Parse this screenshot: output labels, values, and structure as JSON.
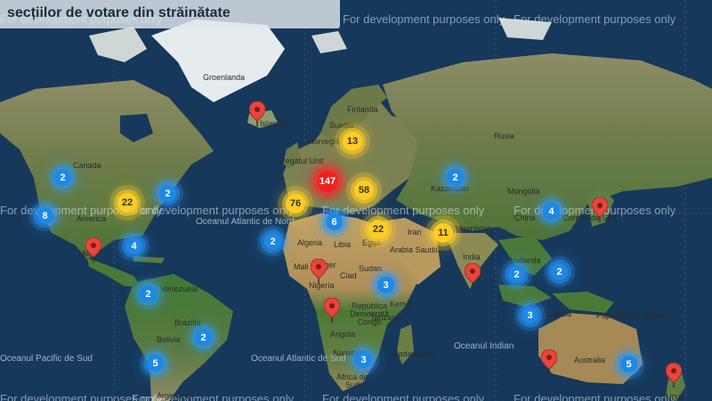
{
  "title": "secțiilor de votare din străinătate",
  "watermark": "For development purposes only",
  "colors": {
    "ocean": "#16385a",
    "land_north": "#8a8a63",
    "land_tropic": "#4d7a3a",
    "desert": "#b89a60",
    "ice": "#e8ecef",
    "cluster_small": "#1e88e5",
    "cluster_medium": "#ffcc22",
    "cluster_large": "#ee2222",
    "pin": "#e8453c"
  },
  "map_labels": {
    "greenland": "Groenlanda",
    "iceland": "Islanda",
    "finland": "Finlanda",
    "sweden": "Suedia",
    "norway": "Norvegia",
    "russia": "Rusia",
    "uk": "Regatul Unit",
    "kazakhstan": "Kazahstan",
    "mongolia": "Mongolia",
    "china": "China",
    "korea": "Coreea de Sud",
    "canada": "Canada",
    "usa": "America",
    "mexico": "Mexic",
    "atlantic_north": "Oceanul Atlantic de Nord",
    "atlantic_south": "Oceanul Atlantic de Sud",
    "pacific": "Oceanul Pacific de Sud",
    "indian": "Oceanul Indian",
    "algeria": "Algeria",
    "libya": "Libia",
    "egypt": "Egipt",
    "mali": "Mali",
    "niger": "Niger",
    "chad": "Ciad",
    "sudan": "Sudan",
    "nigeria": "Nigeria",
    "saudi": "Arabia Saudită",
    "iran": "Iran",
    "afghanistan": "Afganistan",
    "india": "India",
    "thailand": "Thailanda",
    "indonesia": "Indonezia",
    "png": "Papua Noua Guinee",
    "australia": "Australia",
    "kenya": "Kenya",
    "drc": "Republica Democrată Congo",
    "tanzania": "Tanzania",
    "angola": "Angola",
    "namibia": "Namibia",
    "south_africa": "Africa de Sud",
    "madagascar": "Madagascar",
    "venezuela": "Venezuela",
    "brazil": "Brazilia",
    "bolivia": "Bolivia",
    "argentina": "Argentina",
    "noua": "Noua"
  },
  "clusters": [
    {
      "name": "cluster-canada-west",
      "count": "2",
      "color": "blue"
    },
    {
      "name": "cluster-us-west",
      "count": "8",
      "color": "blue"
    },
    {
      "name": "cluster-us-central",
      "count": "22",
      "color": "yellow"
    },
    {
      "name": "cluster-canada-east",
      "count": "2",
      "color": "blue"
    },
    {
      "name": "cluster-us-southeast",
      "count": "4",
      "color": "blue"
    },
    {
      "name": "cluster-venezuela",
      "count": "2",
      "color": "blue"
    },
    {
      "name": "cluster-brazil",
      "count": "2",
      "color": "blue"
    },
    {
      "name": "cluster-south-america",
      "count": "5",
      "color": "blue"
    },
    {
      "name": "cluster-western-europe",
      "count": "76",
      "color": "yellow"
    },
    {
      "name": "cluster-central-europe",
      "count": "147",
      "color": "red"
    },
    {
      "name": "cluster-eastern-europe",
      "count": "58",
      "color": "yellow"
    },
    {
      "name": "cluster-scandinavia",
      "count": "13",
      "color": "yellow"
    },
    {
      "name": "cluster-mediterranean",
      "count": "6",
      "color": "blue"
    },
    {
      "name": "cluster-north-africa",
      "count": "2",
      "color": "blue"
    },
    {
      "name": "cluster-middle-east",
      "count": "22",
      "color": "yellow"
    },
    {
      "name": "cluster-central-asia",
      "count": "11",
      "color": "yellow"
    },
    {
      "name": "cluster-kazakhstan",
      "count": "2",
      "color": "blue"
    },
    {
      "name": "cluster-east-africa",
      "count": "3",
      "color": "blue"
    },
    {
      "name": "cluster-southern-africa",
      "count": "3",
      "color": "blue"
    },
    {
      "name": "cluster-china",
      "count": "4",
      "color": "blue"
    },
    {
      "name": "cluster-southeast-asia",
      "count": "2",
      "color": "blue"
    },
    {
      "name": "cluster-philippines",
      "count": "2",
      "color": "blue"
    },
    {
      "name": "cluster-indonesia",
      "count": "3",
      "color": "blue"
    },
    {
      "name": "cluster-australia",
      "count": "5",
      "color": "blue"
    }
  ],
  "pins": [
    {
      "name": "pin-iceland"
    },
    {
      "name": "pin-mexico"
    },
    {
      "name": "pin-nigeria"
    },
    {
      "name": "pin-angola"
    },
    {
      "name": "pin-india"
    },
    {
      "name": "pin-japan"
    },
    {
      "name": "pin-australia-west"
    },
    {
      "name": "pin-new-zealand"
    }
  ]
}
